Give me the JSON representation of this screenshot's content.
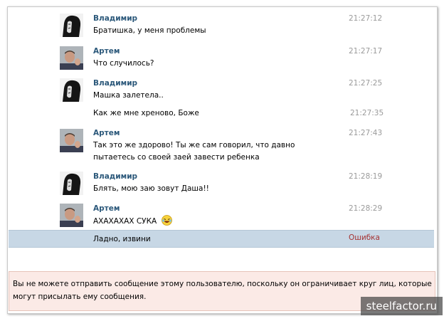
{
  "messages": [
    {
      "author": "Владимир",
      "text": "Братишка, у меня проблемы",
      "time": "21:27:12",
      "avatar": "vladimir-avatar"
    },
    {
      "author": "Артем",
      "text": "Что случилось?",
      "time": "21:27:17",
      "avatar": "artem-avatar"
    },
    {
      "author": "Владимир",
      "text": "Машка залетела..",
      "time": "21:27:25",
      "avatar": "vladimir-avatar"
    },
    {
      "author": "",
      "text": "Как же мне хреново, Боже",
      "time": "21:27:35"
    },
    {
      "author": "Артем",
      "text": "Так это же здорово! Ты же сам говорил, что давно пытаетесь со своей заей завести ребенка",
      "time": "21:27:43",
      "avatar": "artem-avatar"
    },
    {
      "author": "Владимир",
      "text": "Блять, мою заю зовут Даша!!",
      "time": "21:28:19",
      "avatar": "vladimir-avatar"
    },
    {
      "author": "Артем",
      "text": "АХАХАХАХ СУКА",
      "time": "21:28:29",
      "avatar": "artem-avatar",
      "emoji": "laughing-emoji"
    }
  ],
  "failed_message": {
    "text": "Ладно, извини",
    "status": "Ошибка"
  },
  "notice": "Вы не можете отправить сообщение этому пользователю, поскольку он ограничивает круг лиц, которые могут присылать ему сообщения.",
  "watermark": "steelfactor.ru",
  "colors": {
    "author": "#2b587a",
    "time": "#9a9a9a",
    "error": "#a53232",
    "failed_row_bg": "#c7d7e5",
    "notice_bg": "#fbeae6"
  }
}
